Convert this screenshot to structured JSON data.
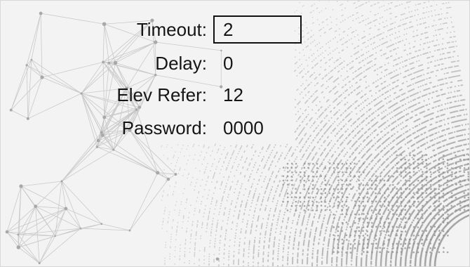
{
  "form": {
    "fields": [
      {
        "label": "Timeout:",
        "value": "2"
      },
      {
        "label": "Delay:",
        "value": "0"
      },
      {
        "label": "Elev Refer:",
        "value": "12"
      },
      {
        "label": "Password:",
        "value": "0000"
      }
    ]
  },
  "colors": {
    "background": "#f3f3f3",
    "text": "#151515",
    "focus_border": "#111111",
    "background_dots": "#9a9a9a"
  }
}
